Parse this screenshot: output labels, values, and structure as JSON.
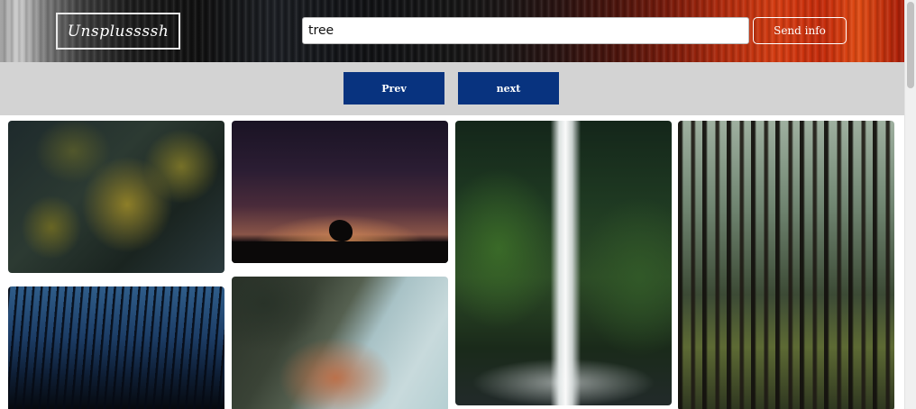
{
  "header": {
    "logo_text": "Unsplussssh",
    "search": {
      "value": "tree"
    },
    "send_button_label": "Send info"
  },
  "pagination": {
    "prev_label": "Prev",
    "next_label": "next"
  },
  "gallery": {
    "photos": [
      {
        "subject": "evergreen branches"
      },
      {
        "subject": "night sky with tree silhouette"
      },
      {
        "subject": "waterfall in jungle"
      },
      {
        "subject": "forest of tall trees"
      },
      {
        "subject": "bare trees against blue sky"
      },
      {
        "subject": "autumn tree on hillside"
      }
    ]
  },
  "colors": {
    "nav_button": "#08337f",
    "nav_bar": "#d3d3d3"
  }
}
